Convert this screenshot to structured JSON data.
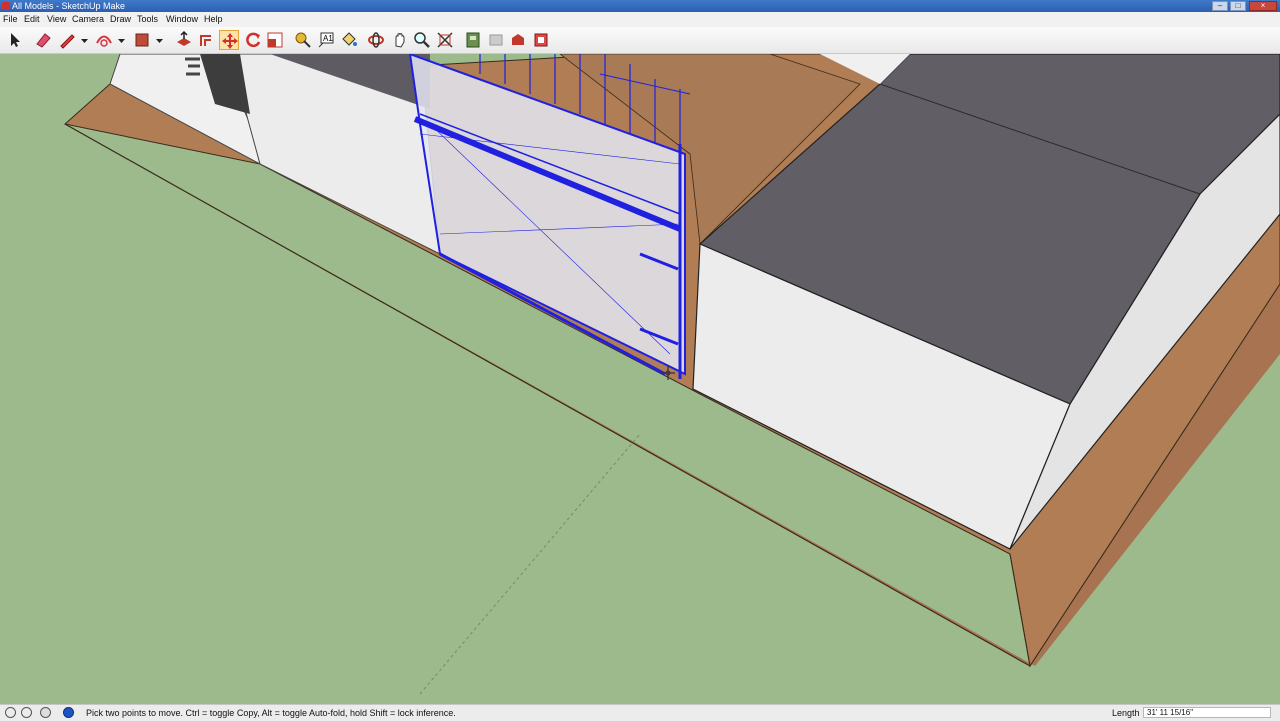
{
  "window": {
    "title": "All Models - SketchUp Make",
    "controls": [
      "–",
      "□",
      "×"
    ]
  },
  "menu": [
    "File",
    "Edit",
    "View",
    "Camera",
    "Draw",
    "Tools",
    "Window",
    "Help"
  ],
  "toolbar": {
    "tools": [
      {
        "icon": "select-arrow-icon"
      },
      {
        "icon": "eraser-icon"
      },
      {
        "icon": "pencil-line-icon"
      },
      {
        "icon": "arc-icon"
      },
      {
        "icon": "rectangle-icon"
      },
      {
        "icon": "push-pull-icon"
      },
      {
        "icon": "offset-icon"
      },
      {
        "icon": "move-icon",
        "active": true
      },
      {
        "icon": "rotate-icon"
      },
      {
        "icon": "scale-icon"
      },
      {
        "icon": "tape-measure-icon"
      },
      {
        "icon": "text-icon"
      },
      {
        "icon": "paint-bucket-icon"
      },
      {
        "icon": "orbit-icon"
      },
      {
        "icon": "pan-icon"
      },
      {
        "icon": "zoom-icon"
      },
      {
        "icon": "zoom-extents-icon"
      },
      {
        "icon": "warehouse-icon"
      },
      {
        "icon": "share-model-icon"
      },
      {
        "icon": "extension-warehouse-icon"
      },
      {
        "icon": "layout-icon"
      }
    ]
  },
  "status": {
    "hint": "Pick two points to move.  Ctrl = toggle Copy, Alt = toggle Auto-fold, hold Shift = lock inference.",
    "measurement_label": "Length",
    "measurement_value": "31' 11 15/16\""
  },
  "colors": {
    "ground": "#9cba8c",
    "soil": "#b07d55",
    "wall": "#ececec",
    "roof": "#5f5b62",
    "selection": "#2020e0"
  }
}
